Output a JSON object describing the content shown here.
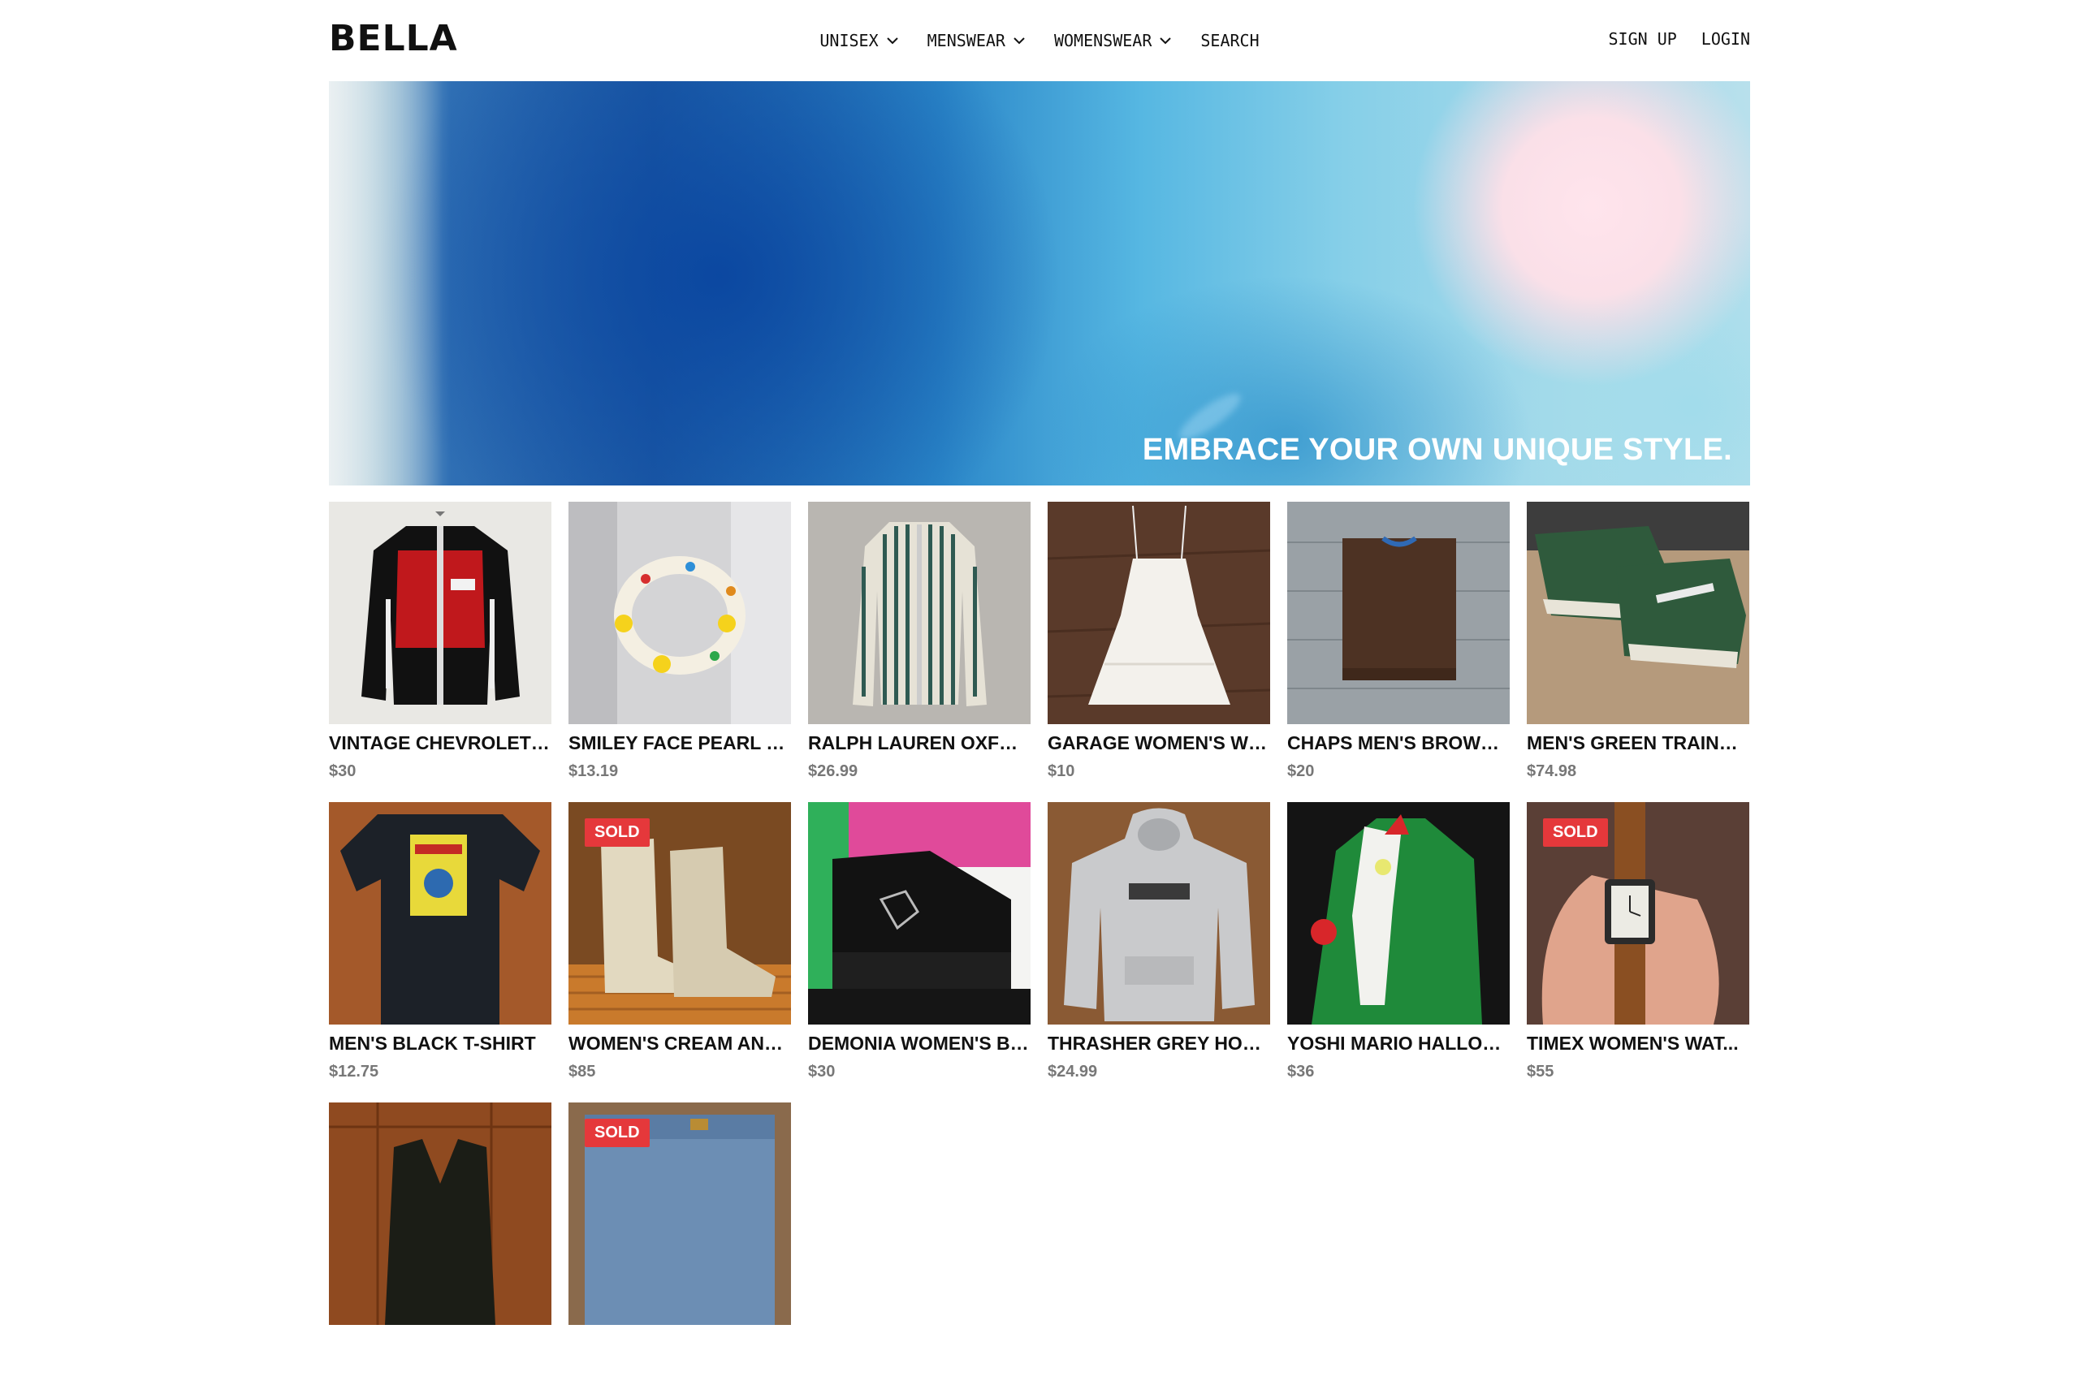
{
  "brand": {
    "logo": "BELLA"
  },
  "nav": {
    "items": [
      {
        "label": "UNISEX",
        "dropdown": true
      },
      {
        "label": "MENSWEAR",
        "dropdown": true
      },
      {
        "label": "WOMENSWEAR",
        "dropdown": true
      },
      {
        "label": "SEARCH",
        "dropdown": false
      }
    ],
    "signup": "SIGN UP",
    "login": "LOGIN"
  },
  "hero": {
    "tagline": "EMBRACE YOUR OWN UNIQUE STYLE."
  },
  "colors": {
    "sold_badge": "#e5383b",
    "price_text": "#777777",
    "text": "#111111"
  },
  "products": [
    {
      "title": "VINTAGE CHEVROLET ...",
      "price": "$30",
      "sold": false,
      "image": "red-black-racing-jacket"
    },
    {
      "title": "SMILEY FACE PEARL B...",
      "price": "$13.19",
      "sold": false,
      "image": "smiley-pearl-bracelet"
    },
    {
      "title": "RALPH LAUREN OXFOR...",
      "price": "$26.99",
      "sold": false,
      "image": "striped-shirt"
    },
    {
      "title": "GARAGE WOMEN'S WH...",
      "price": "$10",
      "sold": false,
      "image": "white-dress"
    },
    {
      "title": "CHAPS MEN'S BROWN ...",
      "price": "$20",
      "sold": false,
      "image": "brown-sweater"
    },
    {
      "title": "MEN'S GREEN TRAINERS",
      "price": "$74.98",
      "sold": false,
      "image": "green-trainers"
    },
    {
      "title": "MEN'S BLACK T-SHIRT",
      "price": "$12.75",
      "sold": false,
      "image": "black-tshirt"
    },
    {
      "title": "WOMEN'S CREAM AND...",
      "price": "$85",
      "sold": true,
      "sold_label": "SOLD",
      "image": "cream-cowboy-boots"
    },
    {
      "title": "DEMONIA WOMEN'S BL...",
      "price": "$30",
      "sold": false,
      "image": "black-platform-shoes"
    },
    {
      "title": "THRASHER GREY HOO...",
      "price": "$24.99",
      "sold": false,
      "image": "grey-hoodie"
    },
    {
      "title": "YOSHI MARIO HALLOW...",
      "price": "$36",
      "sold": false,
      "image": "yoshi-costume"
    },
    {
      "title": "TIMEX WOMEN'S WAT...",
      "price": "$55",
      "sold": true,
      "sold_label": "SOLD",
      "image": "leather-watch"
    },
    {
      "title": "",
      "price": "",
      "sold": false,
      "image": "leather-vest"
    },
    {
      "title": "",
      "price": "",
      "sold": true,
      "sold_label": "SOLD",
      "image": "denim-jeans"
    }
  ]
}
